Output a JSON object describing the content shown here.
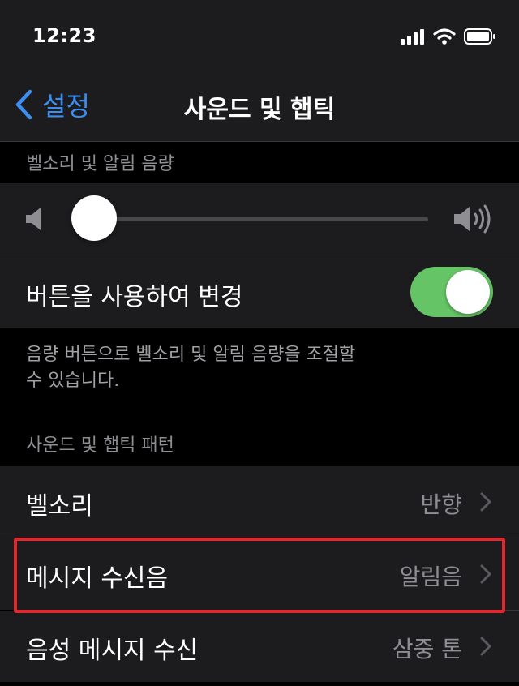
{
  "status_bar": {
    "time": "12:23"
  },
  "nav": {
    "back_label": "설정",
    "title": "사운드 및 햅틱"
  },
  "ringer_section": {
    "header": "벨소리 및 알림 음량",
    "volume_level": 0.0,
    "change_with_buttons": {
      "label": "버튼을 사용하여 변경",
      "enabled": true
    },
    "footer_line1": "음량 버튼으로 벨소리 및 알림 음량을 조절할",
    "footer_line2": "수 있습니다."
  },
  "patterns_section": {
    "header": "사운드 및 햅틱 패턴",
    "rows": [
      {
        "label": "벨소리",
        "value": "반향"
      },
      {
        "label": "메시지 수신음",
        "value": "알림음",
        "highlighted": true
      },
      {
        "label": "음성 메시지 수신",
        "value": "삼중 톤"
      }
    ]
  },
  "colors": {
    "accent": "#3d8ef2",
    "toggle_on": "#65c466",
    "highlight": "#e0282e",
    "cell_background": "#1c1c1e",
    "page_background": "#000000"
  },
  "icons": [
    "back-chevron-icon",
    "signal-icon",
    "wifi-icon",
    "battery-icon",
    "speaker-low-icon",
    "speaker-high-icon",
    "chevron-right-icon"
  ]
}
